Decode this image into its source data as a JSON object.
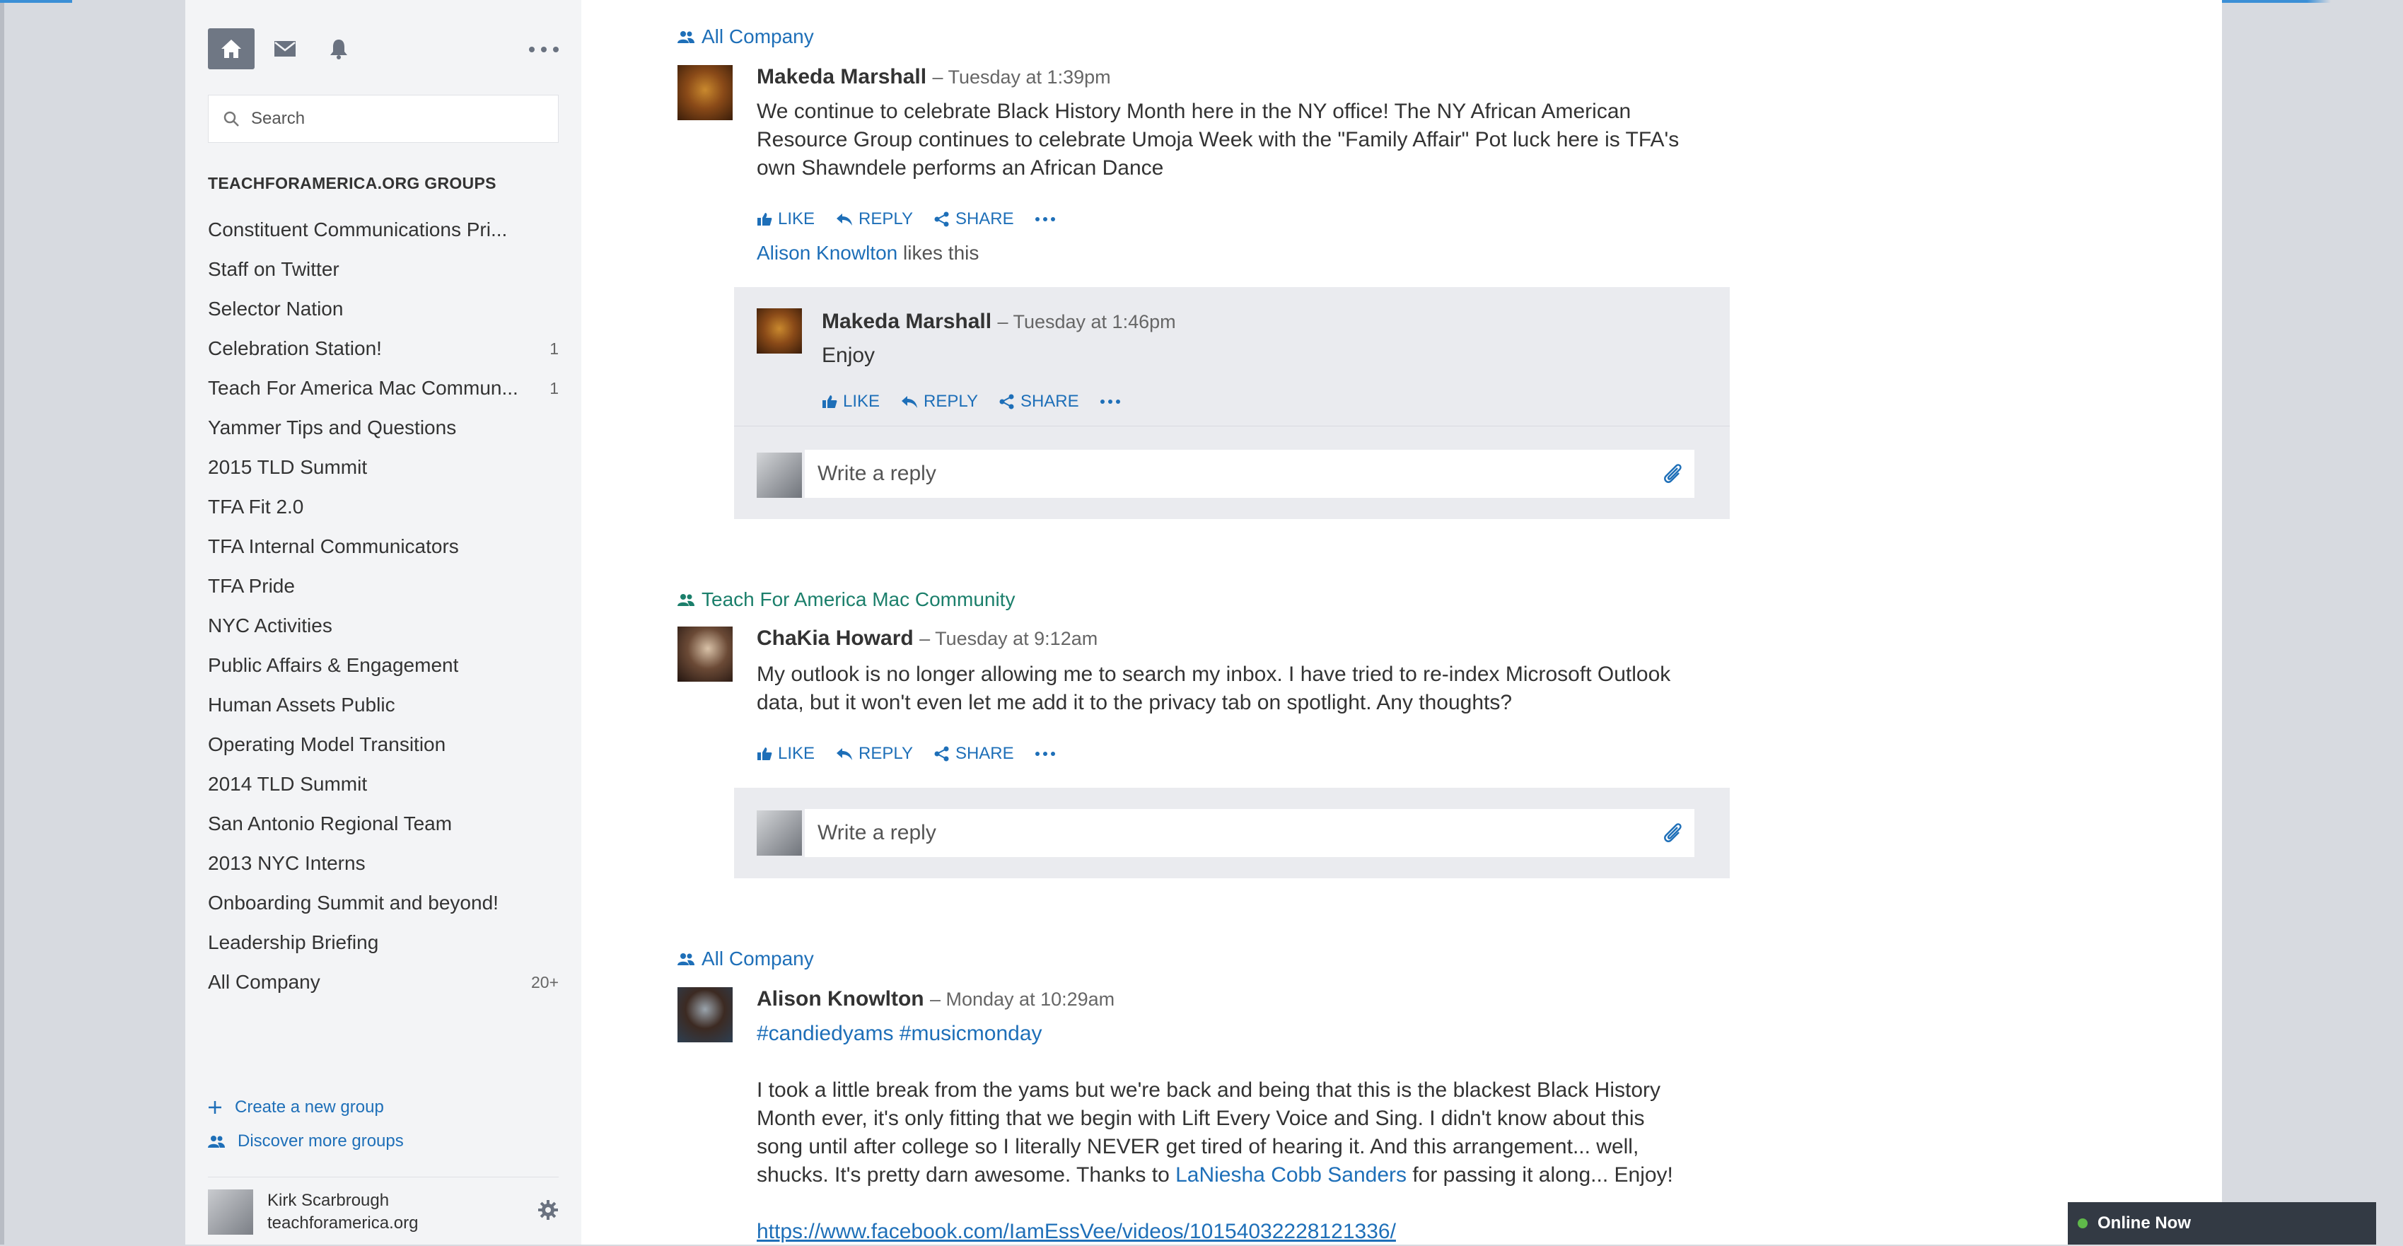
{
  "sidebar": {
    "search_placeholder": "Search",
    "groups_heading": "TEACHFORAMERICA.ORG GROUPS",
    "groups": [
      {
        "name": "Constituent Communications Pri...",
        "count": ""
      },
      {
        "name": "Staff on Twitter",
        "count": ""
      },
      {
        "name": "Selector Nation",
        "count": ""
      },
      {
        "name": "Celebration Station!",
        "count": "1"
      },
      {
        "name": "Teach For America Mac Commun...",
        "count": "1"
      },
      {
        "name": "Yammer Tips and Questions",
        "count": ""
      },
      {
        "name": "2015 TLD Summit",
        "count": ""
      },
      {
        "name": "TFA Fit 2.0",
        "count": ""
      },
      {
        "name": "TFA Internal Communicators",
        "count": ""
      },
      {
        "name": "TFA Pride",
        "count": ""
      },
      {
        "name": "NYC Activities",
        "count": ""
      },
      {
        "name": "Public Affairs & Engagement",
        "count": ""
      },
      {
        "name": "Human Assets Public",
        "count": ""
      },
      {
        "name": "Operating Model Transition",
        "count": ""
      },
      {
        "name": "2014 TLD Summit",
        "count": ""
      },
      {
        "name": "San Antonio Regional Team",
        "count": ""
      },
      {
        "name": "2013 NYC Interns",
        "count": ""
      },
      {
        "name": "Onboarding Summit and beyond!",
        "count": ""
      },
      {
        "name": "Leadership Briefing",
        "count": ""
      },
      {
        "name": "All Company",
        "count": "20+"
      }
    ],
    "create_group": "Create a new group",
    "discover_groups": "Discover more groups",
    "user": {
      "name": "Kirk Scarbrough",
      "org": "teachforamerica.org"
    }
  },
  "actions": {
    "like": "LIKE",
    "reply": "REPLY",
    "share": "SHARE"
  },
  "reply_placeholder": "Write a reply",
  "feed": {
    "post1": {
      "group": "All Company",
      "author": "Makeda Marshall",
      "time": "– Tuesday at 1:39pm",
      "body": "We continue to celebrate Black History Month here in the NY office! The NY African American Resource Group continues to celebrate Umoja Week with the \"Family Affair\" Pot luck here is TFA's own Shawndele performs an African Dance",
      "liker": "Alison Knowlton",
      "likes_suffix": " likes this",
      "reply": {
        "author": "Makeda Marshall",
        "time": "– Tuesday at 1:46pm",
        "body": "Enjoy"
      }
    },
    "post2": {
      "group": "Teach For America Mac Community",
      "author": "ChaKia Howard",
      "time": "– Tuesday at 9:12am",
      "body": "My outlook is no longer allowing me to search my inbox. I have tried to re-index Microsoft Outlook data, but it won't even let me add it to the privacy tab on spotlight. Any thoughts?"
    },
    "post3": {
      "group": "All Company",
      "author": "Alison Knowlton",
      "time": "– Monday at 10:29am",
      "hashtags": "#candiedyams #musicmonday",
      "body_pre": "I took a little break from the yams but we're back and being that this is the blackest Black History Month ever, it's only fitting that we begin with Lift Every Voice and Sing. I didn't know about this song until after college so I literally NEVER get tired of hearing it. And this arrangement... well, shucks. It's pretty darn awesome. Thanks to ",
      "mention": "LaNiesha Cobb Sanders",
      "body_post": " for passing it along... Enjoy!",
      "url": "https://www.facebook.com/IamEssVee/videos/10154032228121336/"
    }
  },
  "online_now": "Online Now",
  "colors": {
    "link": "#1e6fb8",
    "green_group": "#1b7f6b",
    "online": "#5fb94a"
  }
}
